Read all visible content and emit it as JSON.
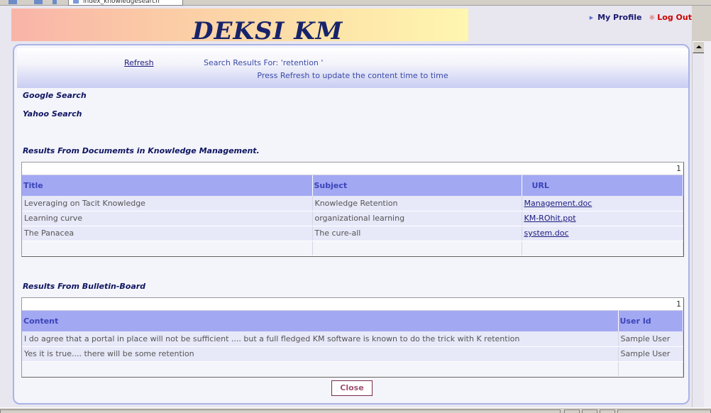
{
  "browser": {
    "tab_title": "index_knowledgesearch"
  },
  "header": {
    "logo": "DEKSI KM",
    "my_profile": "My Profile",
    "log_out": "Log Out"
  },
  "dialog": {
    "refresh_label": "Refresh",
    "search_results_for": "Search Results For: 'retention '",
    "hint": "Press Refresh to update the content time to time",
    "google_search": "Google Search",
    "yahoo_search": "Yahoo Search",
    "close_label": "Close"
  },
  "documents": {
    "heading": "Results From Documemts in Knowledge Management.",
    "page": "1",
    "columns": [
      "Title",
      "Subject",
      "URL"
    ],
    "rows": [
      {
        "title": "Leveraging on Tacit Knowledge",
        "subject": "Knowledge Retention",
        "url": "Management.doc"
      },
      {
        "title": "Learning curve",
        "subject": "organizational learning",
        "url": "KM-ROhit.ppt"
      },
      {
        "title": "The Panacea",
        "subject": "The cure-all",
        "url": "system.doc"
      }
    ]
  },
  "bulletin": {
    "heading": "Results From Bulletin-Board",
    "page": "1",
    "columns": [
      "Content",
      "User Id"
    ],
    "rows": [
      {
        "content": "I do agree that a portal in place will not be sufficient .... but a full fledged KM software is known to do the trick with K retention",
        "user": "Sample User"
      },
      {
        "content": "Yes it is true.... there will be some retention",
        "user": "Sample User"
      }
    ]
  }
}
